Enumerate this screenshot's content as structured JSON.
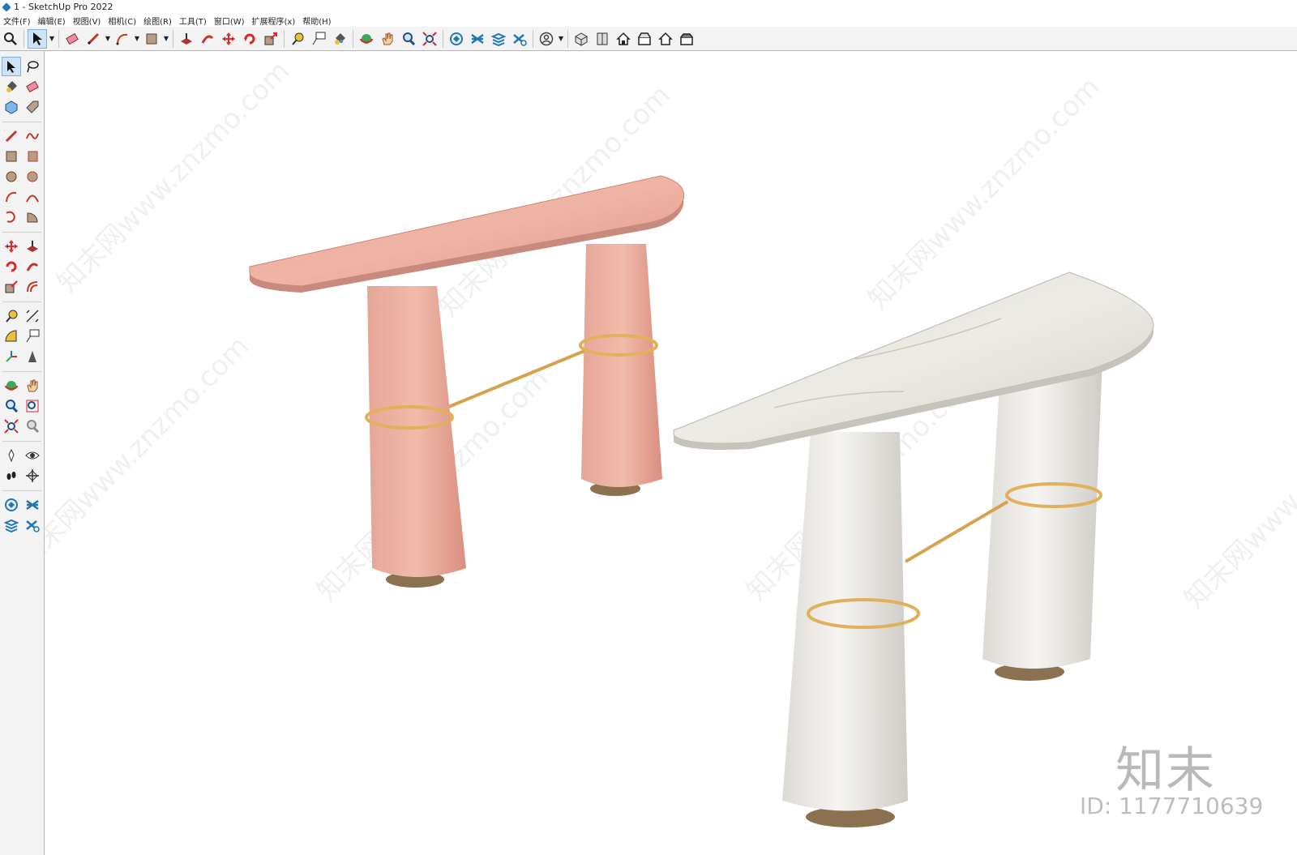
{
  "window": {
    "title": "1 - SketchUp Pro 2022"
  },
  "menu": [
    "文件(F)",
    "编辑(E)",
    "视图(V)",
    "相机(C)",
    "绘图(R)",
    "工具(T)",
    "窗口(W)",
    "扩展程序(x)",
    "帮助(H)"
  ],
  "watermark": {
    "brand": "知末",
    "id_text": "ID: 1177710639",
    "repeat_text": "知末网www.znzmo.com"
  },
  "colors": {
    "toolbar_bg": "#f3f3f3",
    "selected": "#cfe3f7",
    "pink_marble": "#e8a79a",
    "white_marble": "#ecebe7",
    "brass": "#e0b15a"
  }
}
